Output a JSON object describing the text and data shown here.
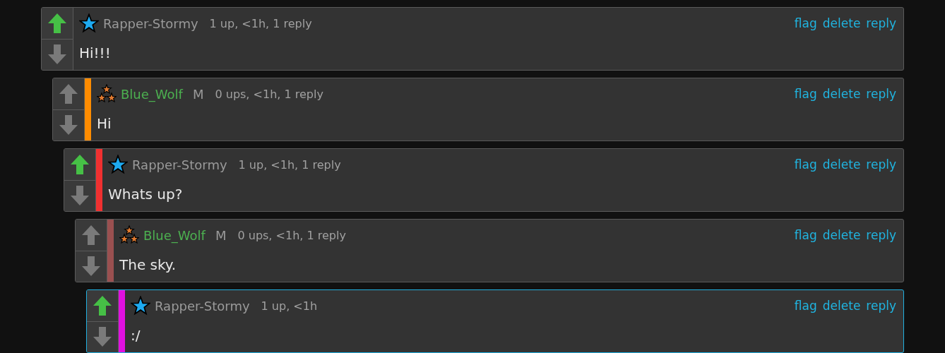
{
  "comments": [
    {
      "author": "Rapper-Stormy",
      "kind": "star",
      "upvoted": true,
      "highlighted": false,
      "meta": "1 up, <1h, 1 reply",
      "body": "Hi!!!",
      "actions": [
        "flag",
        "delete",
        "reply"
      ],
      "children": [
        {
          "author": "Blue_Wolf",
          "kind": "triple-star",
          "tag": "M",
          "upvoted": false,
          "highlighted": false,
          "color": "#ff8c00",
          "meta": "0 ups, <1h, 1 reply",
          "body": "Hi",
          "actions": [
            "flag",
            "delete",
            "reply"
          ],
          "children": [
            {
              "author": "Rapper-Stormy",
              "kind": "star",
              "upvoted": true,
              "highlighted": false,
              "color": "#f03030",
              "meta": "1 up, <1h, 1 reply",
              "body": "Whats up?",
              "actions": [
                "flag",
                "delete",
                "reply"
              ],
              "children": [
                {
                  "author": "Blue_Wolf",
                  "kind": "triple-star",
                  "tag": "M",
                  "upvoted": false,
                  "highlighted": false,
                  "color": "#9a5050",
                  "meta": "0 ups, <1h, 1 reply",
                  "body": "The sky.",
                  "actions": [
                    "flag",
                    "delete",
                    "reply"
                  ],
                  "children": [
                    {
                      "author": "Rapper-Stormy",
                      "kind": "star",
                      "upvoted": true,
                      "highlighted": true,
                      "color": "#e010e0",
                      "meta": "1 up, <1h",
                      "body": ":/",
                      "actions": [
                        "flag",
                        "delete",
                        "reply"
                      ]
                    }
                  ]
                }
              ]
            }
          ]
        }
      ]
    }
  ]
}
